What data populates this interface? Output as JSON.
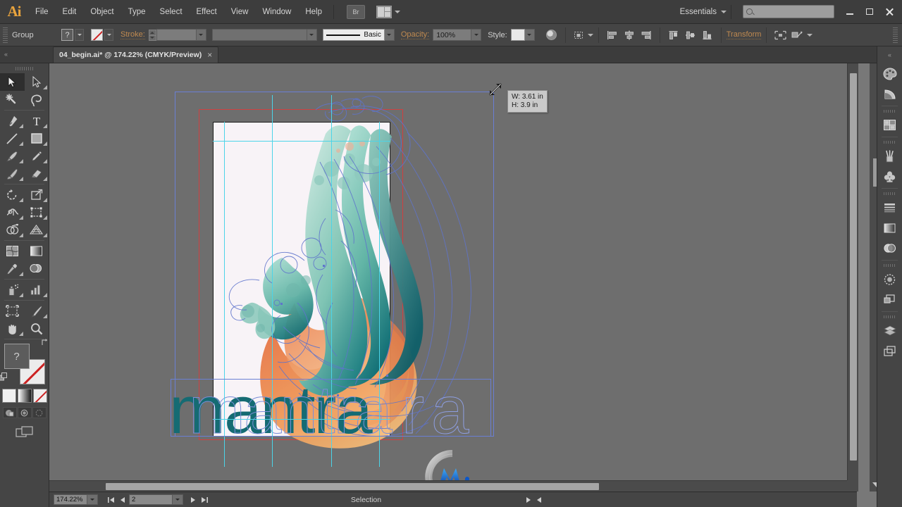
{
  "app": {
    "name": "Adobe Illustrator",
    "logo_text": "Ai"
  },
  "menu": {
    "items": [
      "File",
      "Edit",
      "Object",
      "Type",
      "Select",
      "Effect",
      "View",
      "Window",
      "Help"
    ],
    "bridge_label": "Br",
    "arrange_icon": "arrange-documents-icon",
    "workspace_label": "Essentials",
    "search_placeholder": "",
    "search_value": ""
  },
  "window_controls": {
    "minimize": "minimize-icon",
    "maximize": "maximize-icon",
    "close": "close-icon"
  },
  "control_bar": {
    "selection_type": "Group",
    "fill_label": "?",
    "stroke_swatch": "none",
    "stroke_label": "Stroke:",
    "stroke_weight": "",
    "variable_width": "",
    "brush_definition": "Basic",
    "opacity_label": "Opacity:",
    "opacity_value": "100%",
    "style_label": "Style:",
    "transform_label": "Transform",
    "recolor_icon": "recolor-artwork-icon",
    "align_icons": [
      "align-left-icon",
      "align-center-horizontal-icon",
      "align-right-icon",
      "align-top-icon",
      "align-center-vertical-icon",
      "align-bottom-icon"
    ],
    "isolate_icon": "isolate-selected-object-icon",
    "mask_icon": "make-clipping-mask-icon"
  },
  "document": {
    "tab_title": "04_begin.ai* @ 174.22% (CMYK/Preview)",
    "close_icon": "close-tab-icon"
  },
  "toolbar": {
    "tools": [
      {
        "name": "selection-tool",
        "label": "Selection",
        "active": true,
        "flyout": false
      },
      {
        "name": "direct-selection-tool",
        "label": "Direct Selection",
        "active": false,
        "flyout": true
      },
      {
        "name": "magic-wand-tool",
        "label": "Magic Wand",
        "active": false,
        "flyout": false
      },
      {
        "name": "lasso-tool",
        "label": "Lasso",
        "active": false,
        "flyout": false
      },
      {
        "name": "pen-tool",
        "label": "Pen",
        "active": false,
        "flyout": true
      },
      {
        "name": "type-tool",
        "label": "Type",
        "active": false,
        "flyout": true
      },
      {
        "name": "line-segment-tool",
        "label": "Line Segment",
        "active": false,
        "flyout": true
      },
      {
        "name": "rectangle-tool",
        "label": "Rectangle",
        "active": false,
        "flyout": true
      },
      {
        "name": "paintbrush-tool",
        "label": "Paintbrush",
        "active": false,
        "flyout": true
      },
      {
        "name": "pencil-tool",
        "label": "Pencil",
        "active": false,
        "flyout": true
      },
      {
        "name": "blob-brush-tool",
        "label": "Blob Brush",
        "active": false,
        "flyout": false
      },
      {
        "name": "eraser-tool",
        "label": "Eraser",
        "active": false,
        "flyout": true
      },
      {
        "name": "rotate-tool",
        "label": "Rotate",
        "active": false,
        "flyout": true
      },
      {
        "name": "scale-tool",
        "label": "Scale",
        "active": false,
        "flyout": true
      },
      {
        "name": "width-tool",
        "label": "Width",
        "active": false,
        "flyout": true
      },
      {
        "name": "free-transform-tool",
        "label": "Free Transform",
        "active": false,
        "flyout": false
      },
      {
        "name": "shape-builder-tool",
        "label": "Shape Builder",
        "active": false,
        "flyout": true
      },
      {
        "name": "perspective-grid-tool",
        "label": "Perspective Grid",
        "active": false,
        "flyout": true
      },
      {
        "name": "mesh-tool",
        "label": "Mesh",
        "active": false,
        "flyout": false
      },
      {
        "name": "gradient-tool",
        "label": "Gradient",
        "active": false,
        "flyout": false
      },
      {
        "name": "eyedropper-tool",
        "label": "Eyedropper",
        "active": false,
        "flyout": true
      },
      {
        "name": "blend-tool",
        "label": "Blend",
        "active": false,
        "flyout": false
      },
      {
        "name": "symbol-sprayer-tool",
        "label": "Symbol Sprayer",
        "active": false,
        "flyout": true
      },
      {
        "name": "column-graph-tool",
        "label": "Column Graph",
        "active": false,
        "flyout": true
      },
      {
        "name": "artboard-tool",
        "label": "Artboard",
        "active": false,
        "flyout": false
      },
      {
        "name": "slice-tool",
        "label": "Slice",
        "active": false,
        "flyout": true
      },
      {
        "name": "hand-tool",
        "label": "Hand",
        "active": false,
        "flyout": true
      },
      {
        "name": "zoom-tool",
        "label": "Zoom",
        "active": false,
        "flyout": false
      }
    ],
    "fill_label": "?",
    "stroke_state": "none",
    "color_modes": [
      "color-swatch-button",
      "gradient-button",
      "none-button"
    ],
    "draw_modes": [
      "draw-normal-button",
      "draw-behind-button",
      "draw-inside-button"
    ],
    "screen_mode": "change-screen-mode-button"
  },
  "canvas": {
    "artwork_title": "phoenix flame illustration",
    "text_object": "mantra",
    "ghost_text": "ra",
    "tooltip": {
      "width_line": "W: 3.61 in",
      "height_line": "H: 3.9 in"
    },
    "colors": {
      "artboard_bg": "#f8f3f7",
      "bleed_guide": "#d04040",
      "smart_guide": "#4cd4e8",
      "selection_path": "#6a7fd4",
      "teal_dark": "#0f6a72",
      "teal_mid": "#4ba99c",
      "teal_light": "#9fd3c6",
      "orange_dark": "#e2663c",
      "orange_mid": "#ee8b48",
      "orange_light": "#f4b06a",
      "canvas_bg": "#6e6e6e"
    }
  },
  "status_bar": {
    "zoom_level": "174.22%",
    "artboard_number": "2",
    "status_label": "Selection",
    "first_icon": "first-artboard-icon",
    "prev_icon": "previous-artboard-icon",
    "next_icon": "next-artboard-icon",
    "last_icon": "last-artboard-icon"
  },
  "dock": {
    "groups": [
      [
        "color-panel-icon",
        "color-guide-panel-icon"
      ],
      [
        "swatches-panel-icon"
      ],
      [
        "brushes-panel-icon",
        "symbols-panel-icon"
      ],
      [
        "stroke-panel-icon",
        "gradient-panel-icon",
        "transparency-panel-icon"
      ],
      [
        "appearance-panel-icon",
        "graphic-styles-panel-icon"
      ],
      [
        "layers-panel-icon",
        "artboards-panel-icon"
      ]
    ],
    "expand_icon": "expand-panels-icon"
  }
}
